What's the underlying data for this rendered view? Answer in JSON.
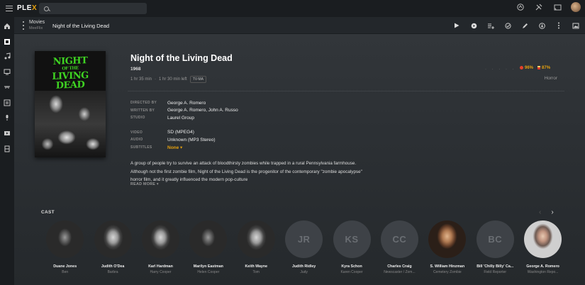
{
  "app": {
    "logo_text": "PLE",
    "logo_x": "X"
  },
  "header": {
    "search_placeholder": ""
  },
  "breadcrumb": {
    "library": "Movies",
    "server": "MeeFlix",
    "title": "Night of the Living Dead"
  },
  "movie": {
    "poster_title_top": "NIGHT",
    "poster_title_mid": "OF THE",
    "poster_title_living": "LIVING",
    "poster_title_bottom": "DEAD",
    "title": "Night of the Living Dead",
    "year": "1968",
    "duration": "1 hr 35 min",
    "separator": "·",
    "time_left": "1 hr 30 min left",
    "content_rating": "TV-MA",
    "user_rating_dots": "· · · · ·",
    "critic_rating": "96%",
    "audience_rating": "87%",
    "genre": "Horror"
  },
  "details": {
    "directed_by_label": "DIRECTED BY",
    "directed_by": "George A. Romero",
    "written_by_label": "WRITTEN BY",
    "written_by": "George A. Romero, John A. Russo",
    "studio_label": "STUDIO",
    "studio": "Laurel Group",
    "video_label": "VIDEO",
    "video": "SD (MPEG4)",
    "audio_label": "AUDIO",
    "audio": "Unknown (MP3 Stereo)",
    "subtitles_label": "SUBTITLES",
    "subtitles": "None ▾"
  },
  "summary": {
    "text": "A group of people try to survive an attack of bloodthirsty zombies while trapped in a rural Pennsylvania farmhouse. Although not the first zombie film, Night of the Living Dead is the progenitor of the contemporary \"zombie apocalypse\" horror film, and it greatly influenced the modern pop-culture",
    "read_more": "READ MORE ▾"
  },
  "cast": {
    "label": "CAST",
    "prev": "‹",
    "next": "›",
    "members": [
      {
        "name": "Duane Jones",
        "role": "Ben",
        "initials": "",
        "style": "photo dark"
      },
      {
        "name": "Judith O'Dea",
        "role": "Barbra",
        "initials": "",
        "style": "photo"
      },
      {
        "name": "Karl Hardman",
        "role": "Harry Cooper",
        "initials": "",
        "style": "photo"
      },
      {
        "name": "Marilyn Eastman",
        "role": "Helen Cooper",
        "initials": "",
        "style": "photo dark"
      },
      {
        "name": "Keith Wayne",
        "role": "Tom",
        "initials": "",
        "style": "photo"
      },
      {
        "name": "Judith Ridley",
        "role": "Judy",
        "initials": "JR",
        "style": ""
      },
      {
        "name": "Kyra Schon",
        "role": "Karen Cooper",
        "initials": "KS",
        "style": ""
      },
      {
        "name": "Charles Craig",
        "role": "Newscaster / Zom...",
        "initials": "CC",
        "style": ""
      },
      {
        "name": "S. William Hinzman",
        "role": "Cemetery Zombie",
        "initials": "",
        "style": "photo color"
      },
      {
        "name": "Bill 'Chilly Billy' Ca...",
        "role": "Field Reporter",
        "initials": "BC",
        "style": ""
      },
      {
        "name": "George A. Romero",
        "role": "Washington Repo...",
        "initials": "",
        "style": "photo color2"
      }
    ]
  }
}
